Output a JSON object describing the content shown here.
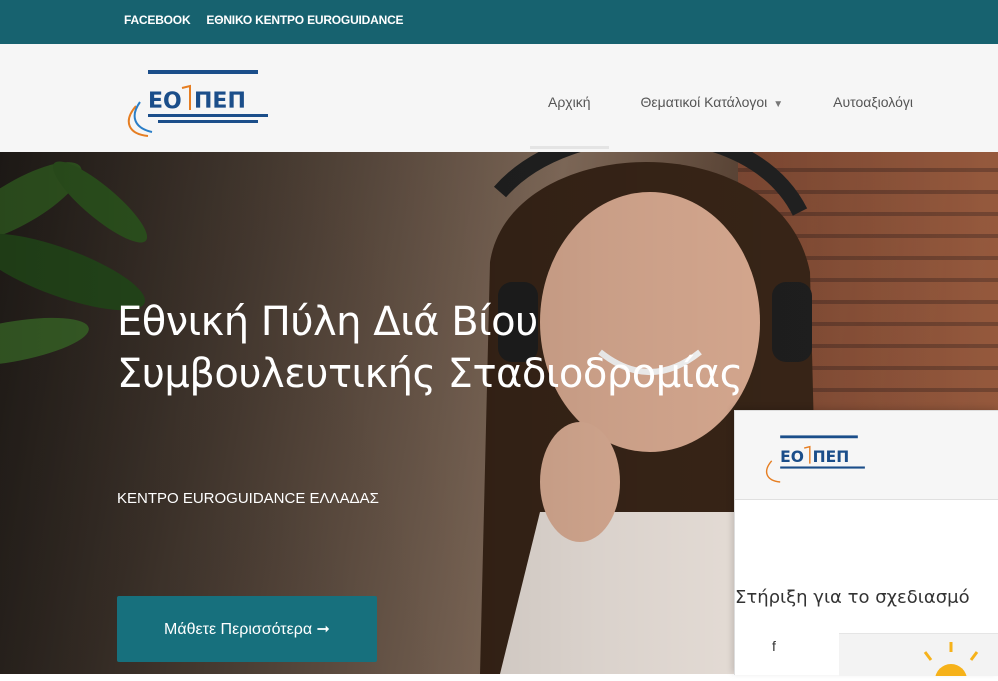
{
  "topbar": {
    "links": [
      "FACEBOOK",
      "ΕΘΝΙΚΟ ΚΕΝΤΡΟ EUROGUIDANCE"
    ]
  },
  "header": {
    "nav": [
      {
        "label": "Αρχική",
        "active": true
      },
      {
        "label": "Θεματικοί Κατάλογοι",
        "dropdown": true
      },
      {
        "label": "Αυτοαξιολόγι"
      }
    ]
  },
  "hero": {
    "title_line1": "Εθνική Πύλη Διά Βίου",
    "title_line2": "Συμβουλευτικής Σταδιοδρομίας",
    "subtitle": "ΚΕΝΤΡΟ EUROGUIDANCE ΕΛΛΑΔΑΣ",
    "button": "Μάθετε Περισσότερα ➞"
  },
  "popup": {
    "text": "Στήριξη για το σχεδιασμό",
    "social_icon": "f"
  },
  "colors": {
    "topbar": "#17626f",
    "button": "#17707d"
  }
}
